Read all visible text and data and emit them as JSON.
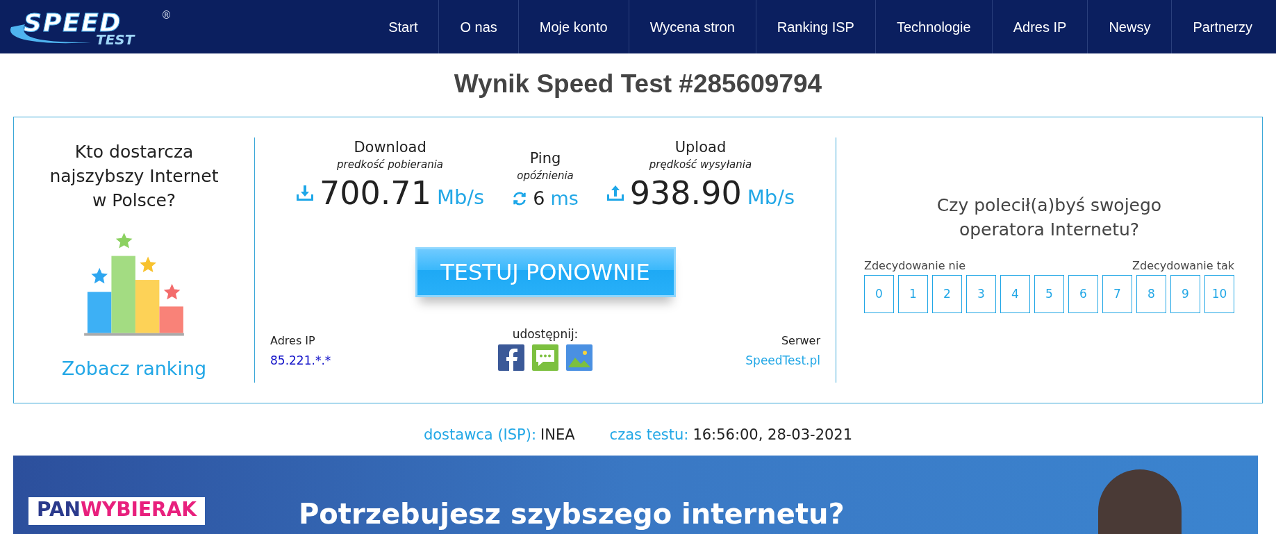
{
  "header": {
    "logo": {
      "word1": "SPEED",
      "word2": "TEST",
      "mark": "®"
    },
    "nav": [
      {
        "label": "Start"
      },
      {
        "label": "O nas"
      },
      {
        "label": "Moje konto"
      },
      {
        "label": "Wycena stron"
      },
      {
        "label": "Ranking ISP"
      },
      {
        "label": "Technologie"
      },
      {
        "label": "Adres IP"
      },
      {
        "label": "Newsy"
      },
      {
        "label": "Partnerzy"
      }
    ]
  },
  "title": "Wynik Speed Test #285609794",
  "ranking": {
    "question": "Kto dostarcza najszybszy Internet w Polsce?",
    "link": "Zobacz ranking"
  },
  "metrics": [
    {
      "kind": "download",
      "label": "Download",
      "sublabel": "predkość pobierania",
      "value": "700.71",
      "unit": "Mb/s"
    },
    {
      "kind": "ping",
      "label": "Ping",
      "sublabel": "opóźnienia",
      "value": "6",
      "unit": "ms"
    },
    {
      "kind": "upload",
      "label": "Upload",
      "sublabel": "prędkość wysyłania",
      "value": "938.90",
      "unit": "Mb/s"
    }
  ],
  "retest_button": "TESTUJ PONOWNIE",
  "ip": {
    "label": "Adres IP",
    "value": "85.221.*.*"
  },
  "share": {
    "label": "udostępnij:",
    "items": [
      {
        "kind": "facebook"
      },
      {
        "kind": "message"
      },
      {
        "kind": "image"
      }
    ]
  },
  "server": {
    "label": "Serwer",
    "value": "SpeedTest.pl"
  },
  "survey": {
    "question": "Czy polecił(a)byś swojego operatora Internetu?",
    "low_label": "Zdecydowanie nie",
    "high_label": "Zdecydowanie tak",
    "options": [
      "0",
      "1",
      "2",
      "3",
      "4",
      "5",
      "6",
      "7",
      "8",
      "9",
      "10"
    ]
  },
  "info": [
    {
      "label": "dostawca (ISP):",
      "value": "INEA"
    },
    {
      "label": "czas testu:",
      "value": "16:56:00, 28-03-2021"
    }
  ],
  "banner": {
    "logo_part1": "PAN",
    "logo_part2": "WYBIERAK",
    "headline": "Potrzebujesz szybszego internetu?"
  }
}
